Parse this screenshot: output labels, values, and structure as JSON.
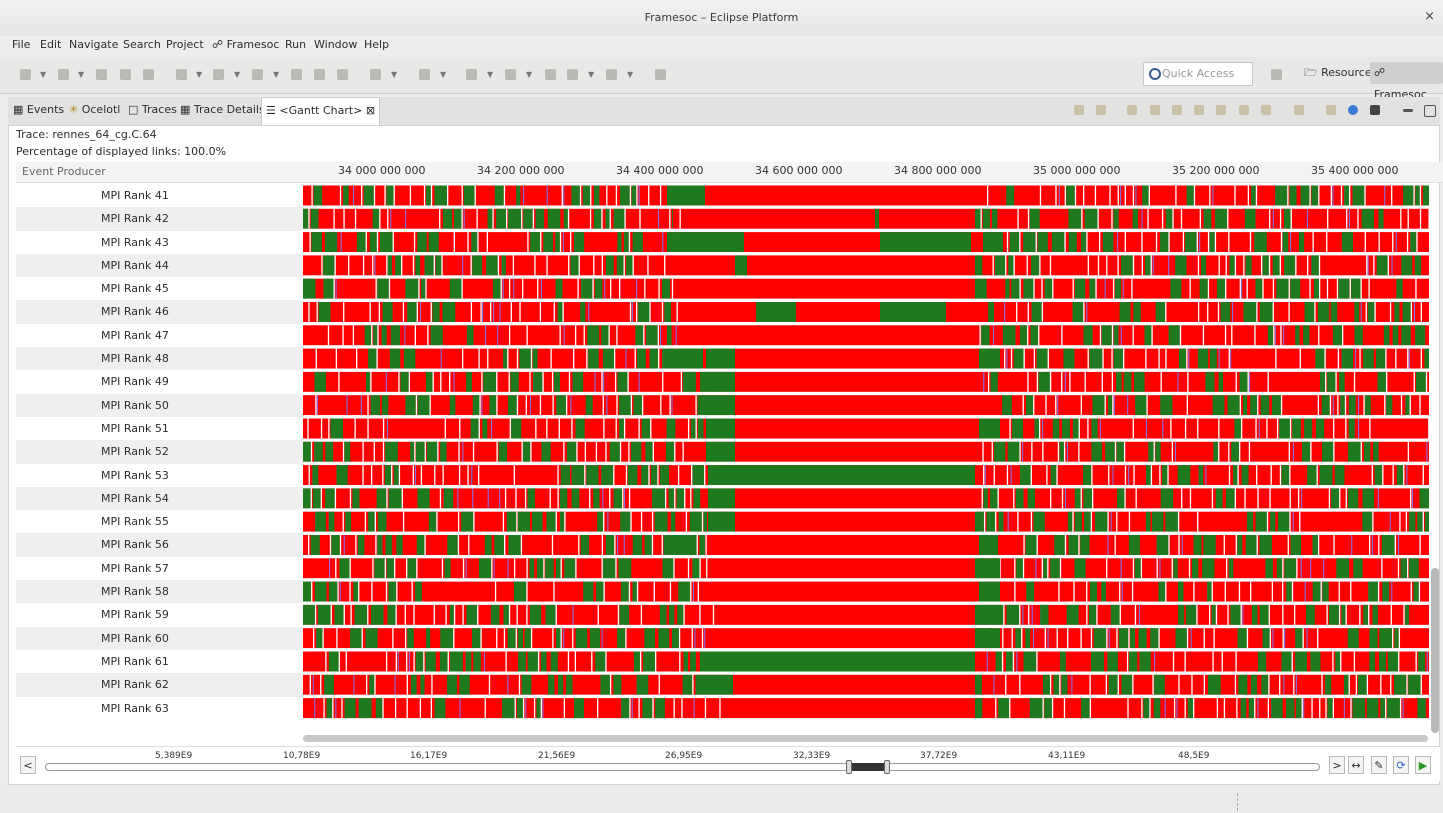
{
  "window": {
    "title": "Framesoc – Eclipse Platform",
    "close": "×"
  },
  "menu": [
    "File",
    "Edit",
    "Navigate",
    "Search",
    "Project",
    "Framesoc",
    "Run",
    "Window",
    "Help"
  ],
  "toolbar": {
    "quick_access_placeholder": "Quick Access",
    "perspectives": [
      "Resource",
      "Framesoc"
    ]
  },
  "tabs": [
    {
      "label": "Events",
      "active": false
    },
    {
      "label": "Ocelotl",
      "active": false
    },
    {
      "label": "Traces",
      "active": false
    },
    {
      "label": "Trace Details",
      "active": false
    },
    {
      "label": "<Gantt Chart>",
      "active": true,
      "close": "⊠"
    }
  ],
  "gantt": {
    "trace_line": "Trace: rennes_64_cg.C.64",
    "links_line": "Percentage of displayed links: 100.0%",
    "column_header": "Event Producer",
    "time_ticks": [
      "34 000 000 000",
      "34 200 000 000",
      "34 400 000 000",
      "34 600 000 000",
      "34 800 000 000",
      "35 000 000 000",
      "35 200 000 000",
      "35 400 000 000"
    ],
    "producers": [
      "MPI Rank 41",
      "MPI Rank 42",
      "MPI Rank 43",
      "MPI Rank 44",
      "MPI Rank 45",
      "MPI Rank 46",
      "MPI Rank 47",
      "MPI Rank 48",
      "MPI Rank 49",
      "MPI Rank 50",
      "MPI Rank 51",
      "MPI Rank 52",
      "MPI Rank 53",
      "MPI Rank 54",
      "MPI Rank 55",
      "MPI Rank 56",
      "MPI Rank 57",
      "MPI Rank 58",
      "MPI Rank 59",
      "MPI Rank 60",
      "MPI Rank 61",
      "MPI Rank 62",
      "MPI Rank 63"
    ],
    "colors": {
      "state_a": "#ff0000",
      "state_b": "#1f7a1f",
      "link": "#7a7af0",
      "row_bg": "#ffffff"
    }
  },
  "timeline": {
    "labels": [
      "5,389E9",
      "10,78E9",
      "16,17E9",
      "21,56E9",
      "26,95E9",
      "32,33E9",
      "37,72E9",
      "43,11E9",
      "48,5E9"
    ],
    "left_button": "<",
    "right_button": ">",
    "fit_button": "↔",
    "pencil_icon": "pencil-icon",
    "refresh_icon": "refresh-icon",
    "play_icon": "play-icon"
  }
}
